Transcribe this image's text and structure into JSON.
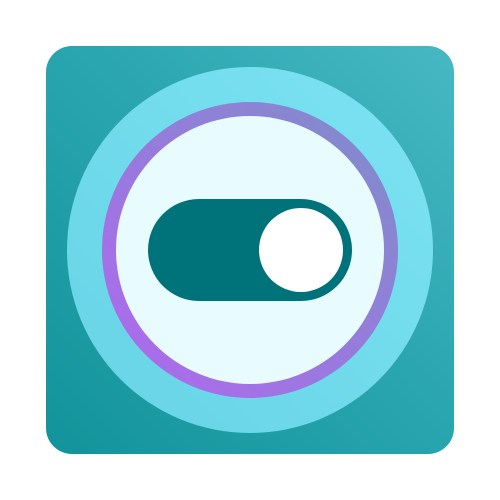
{
  "icon": {
    "name": "toggle-switch-app-icon",
    "symbol": "toggle-switch-icon",
    "state": "on"
  },
  "colors": {
    "tile_light": "#47b8c3",
    "tile_dark": "#12939a",
    "outer_ring": "#70d9ea",
    "ring_purple": "#b068ef",
    "ring_slate": "#7e8ec9",
    "inner_disc": "#e8fbff",
    "switch_track": "#00737a",
    "switch_knob": "#ffffff"
  }
}
